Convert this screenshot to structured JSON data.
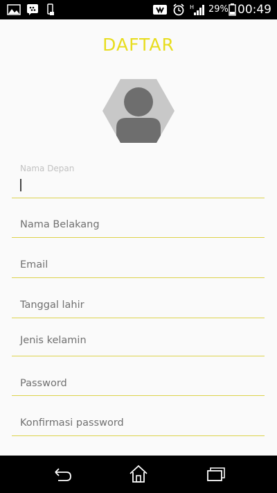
{
  "status_bar": {
    "left_icons": [
      "image-icon",
      "bbm-icon",
      "phone-outline-icon"
    ],
    "right_icons": [
      "nfc-icon",
      "alarm-icon",
      "signal-h-icon",
      "battery-icon"
    ],
    "battery": "29%",
    "time": "00:49"
  },
  "header": {
    "title": "DAFTAR"
  },
  "avatar": {
    "icon": "user-silhouette-icon"
  },
  "form": {
    "first_name": {
      "label": "Nama Depan",
      "value": ""
    },
    "last_name": {
      "placeholder": "Nama Belakang"
    },
    "email": {
      "placeholder": "Email"
    },
    "birth_date": {
      "placeholder": "Tanggal lahir"
    },
    "gender": {
      "placeholder": "Jenis kelamin"
    },
    "password": {
      "placeholder": "Password"
    },
    "confirm_password": {
      "placeholder": "Konfirmasi password"
    }
  },
  "nav_bar": {
    "buttons": [
      "back-icon",
      "home-icon",
      "recents-icon"
    ]
  },
  "colors": {
    "accent": "#e8dd1e",
    "underline": "#dcd24a",
    "background": "#fafafa"
  }
}
